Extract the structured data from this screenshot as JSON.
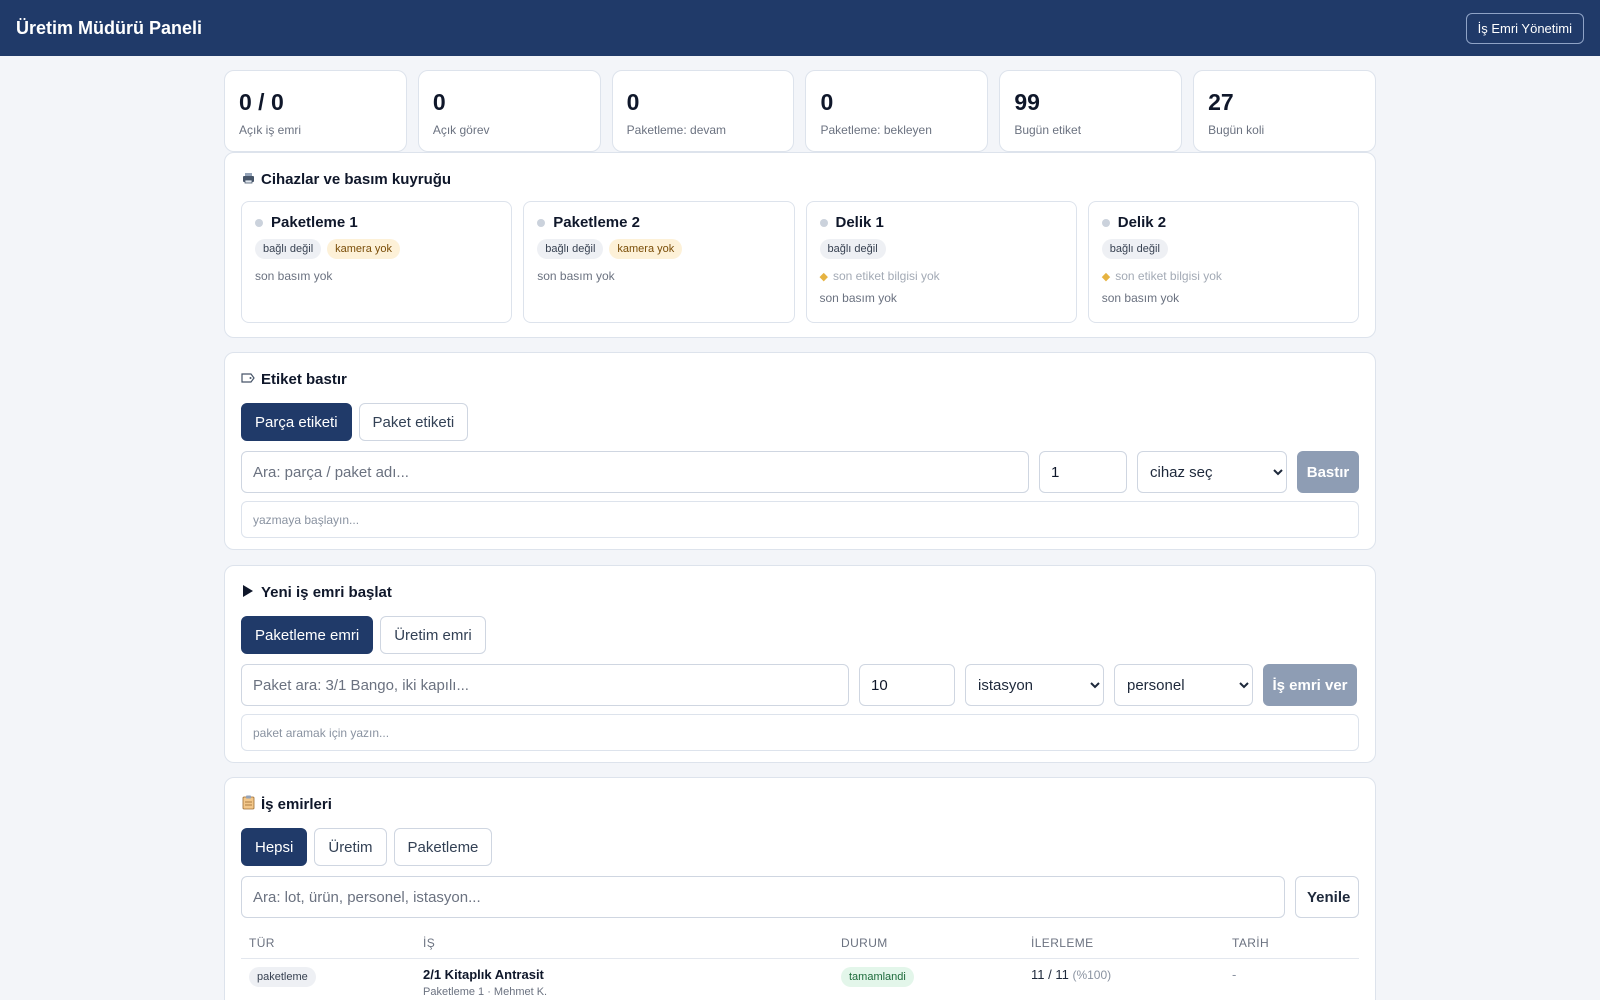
{
  "header": {
    "title": "Üretim Müdürü Paneli",
    "nav_button": "İş Emri Yönetimi"
  },
  "stats": [
    {
      "value": "0 / 0",
      "label": "Açık iş emri"
    },
    {
      "value": "0",
      "label": "Açık görev"
    },
    {
      "value": "0",
      "label": "Paketleme: devam"
    },
    {
      "value": "0",
      "label": "Paketleme: bekleyen"
    },
    {
      "value": "99",
      "label": "Bugün etiket"
    },
    {
      "value": "27",
      "label": "Bugün koli"
    }
  ],
  "devices": {
    "title": "Cihazlar ve basım kuyruğu",
    "items": [
      {
        "name": "Paketleme 1",
        "status": "bağlı değil",
        "camera": "kamera yok",
        "last_print": "son basım yok"
      },
      {
        "name": "Paketleme 2",
        "status": "bağlı değil",
        "camera": "kamera yok",
        "last_print": "son basım yok"
      },
      {
        "name": "Delik 1",
        "status": "bağlı değil",
        "label_info": "son etiket bilgisi yok",
        "last_print": "son basım yok"
      },
      {
        "name": "Delik 2",
        "status": "bağlı değil",
        "label_info": "son etiket bilgisi yok",
        "last_print": "son basım yok"
      }
    ]
  },
  "print_label": {
    "title": "Etiket bastır",
    "tabs": [
      "Parça etiketi",
      "Paket etiketi"
    ],
    "search_placeholder": "Ara: parça / paket adı...",
    "quantity": "1",
    "device_select": "cihaz seç",
    "print_button": "Bastır",
    "hint": "yazmaya başlayın..."
  },
  "new_order": {
    "title": "Yeni iş emri başlat",
    "tabs": [
      "Paketleme emri",
      "Üretim emri"
    ],
    "search_placeholder": "Paket ara: 3/1 Bango, iki kapılı...",
    "quantity": "10",
    "station_select": "istasyon",
    "staff_select": "personel",
    "submit_button": "İş emri ver",
    "hint": "paket aramak için yazın..."
  },
  "orders": {
    "title": "İş emirleri",
    "tabs": [
      "Hepsi",
      "Üretim",
      "Paketleme"
    ],
    "search_placeholder": "Ara: lot, ürün, personel, istasyon...",
    "refresh_button": "Yenile",
    "columns": [
      "TÜR",
      "İŞ",
      "DURUM",
      "İLERLEME",
      "TARİH"
    ],
    "rows": [
      {
        "type": "paketleme",
        "title": "2/1 Kitaplık Antrasit",
        "subtitle": "Paketleme 1 · Mehmet K.",
        "status": "tamamlandi",
        "progress": "11 / 11",
        "progress_pct": "(%100)",
        "date": "-"
      }
    ]
  },
  "colors": {
    "header_bg": "#203a69",
    "primary_disabled": "#8e9db4",
    "page_bg": "#f3f5f9"
  }
}
